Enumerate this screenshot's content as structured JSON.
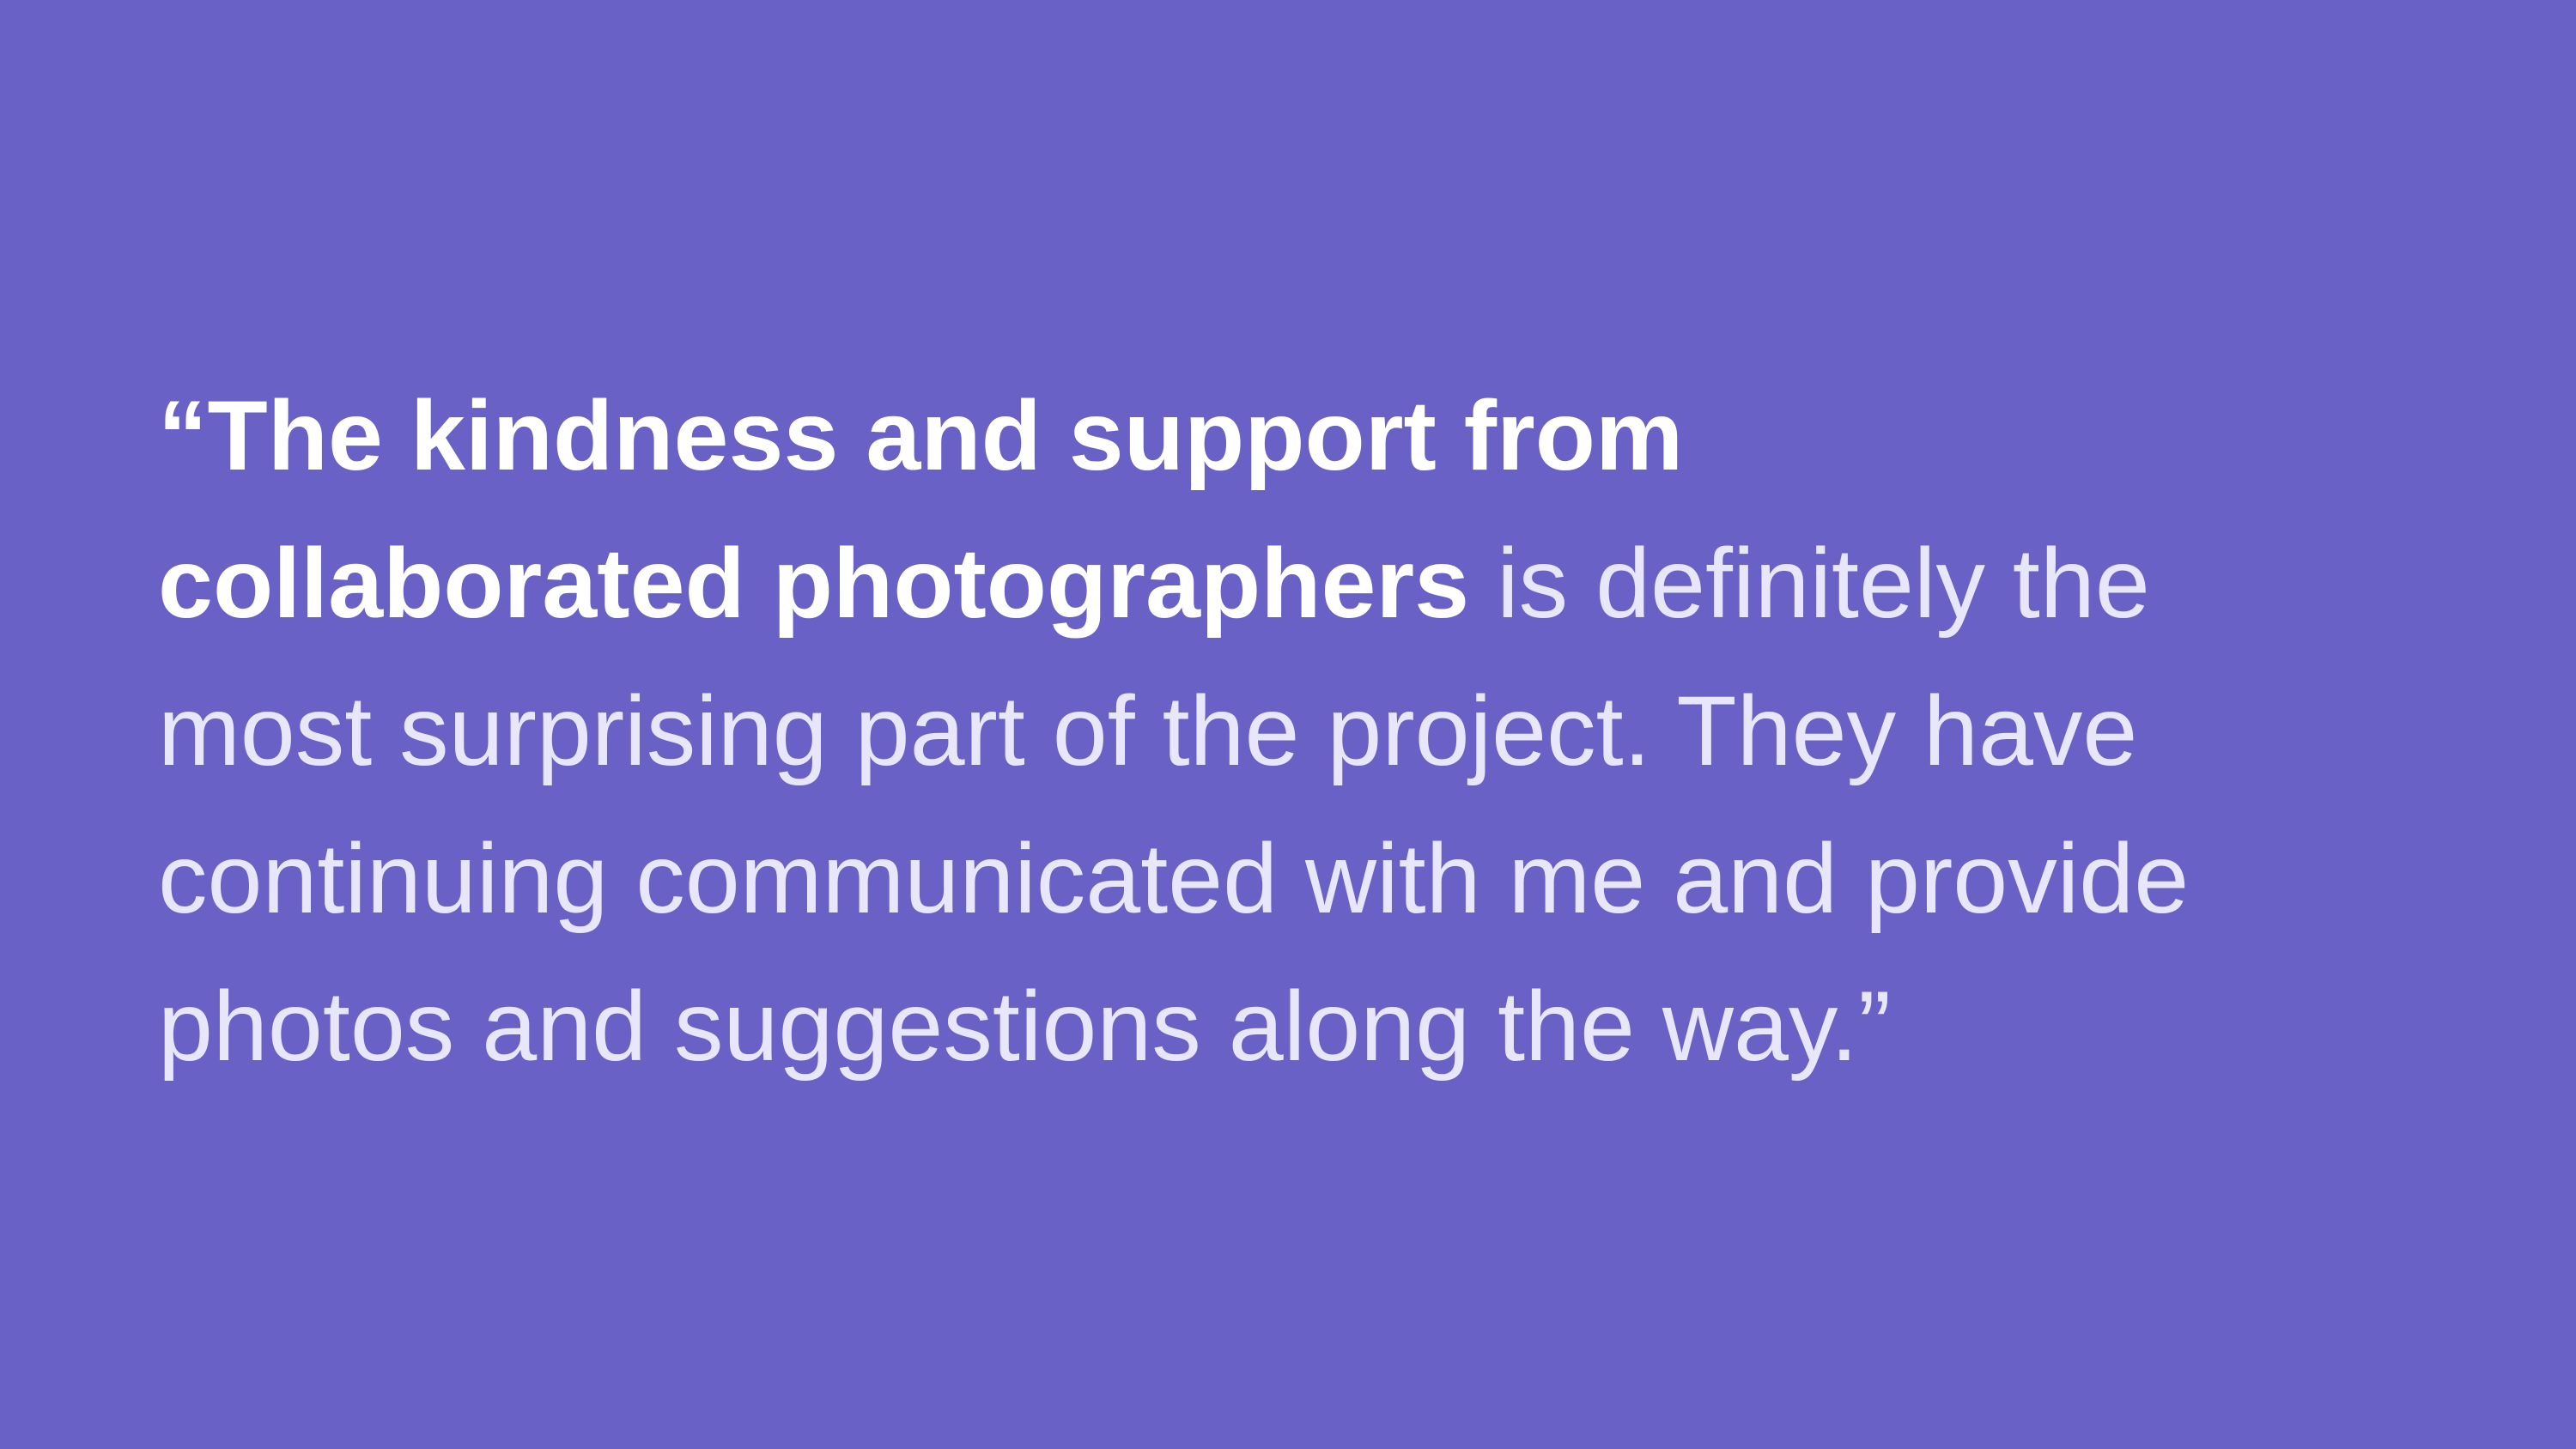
{
  "colors": {
    "background": "#6961C6",
    "emphasis_text": "#FFFFFF",
    "body_text": "#E8E6FA"
  },
  "quote": {
    "line1": {
      "emphasis": "“The kindness and support from"
    },
    "line2": {
      "emphasis": "collaborated photographers",
      "text": " is definitely the"
    },
    "line3": {
      "text": "most surprising part of the project. They have"
    },
    "line4": {
      "text": "continuing communicated with me and provide"
    },
    "line5": {
      "text": "photos and suggestions along the way.”"
    }
  }
}
